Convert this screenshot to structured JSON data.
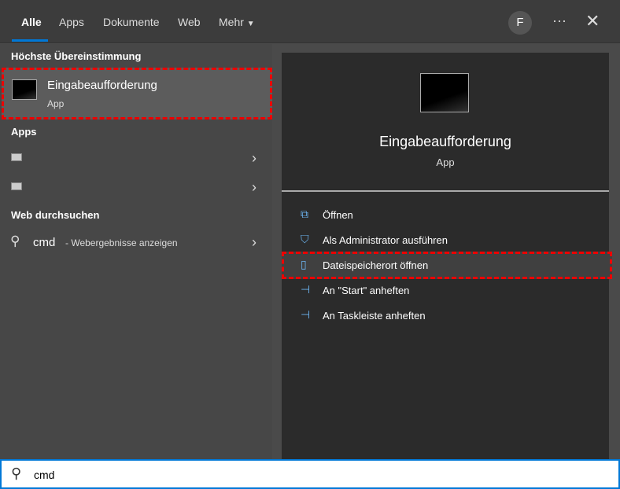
{
  "tabs": [
    "Alle",
    "Apps",
    "Dokumente",
    "Web",
    "Mehr"
  ],
  "avatar": "F",
  "left": {
    "best_match_heading": "Höchste Übereinstimmung",
    "best_match": {
      "title": "Eingabeaufforderung",
      "subtitle": "App"
    },
    "apps_heading": "Apps",
    "web_heading": "Web durchsuchen",
    "web_query": "cmd",
    "web_suffix": "- Webergebnisse anzeigen"
  },
  "right": {
    "title": "Eingabeaufforderung",
    "subtitle": "App",
    "actions": [
      "Öffnen",
      "Als Administrator ausführen",
      "Dateispeicherort öffnen",
      "An \"Start\" anheften",
      "An Taskleiste anheften"
    ]
  },
  "search": {
    "value": "cmd"
  }
}
